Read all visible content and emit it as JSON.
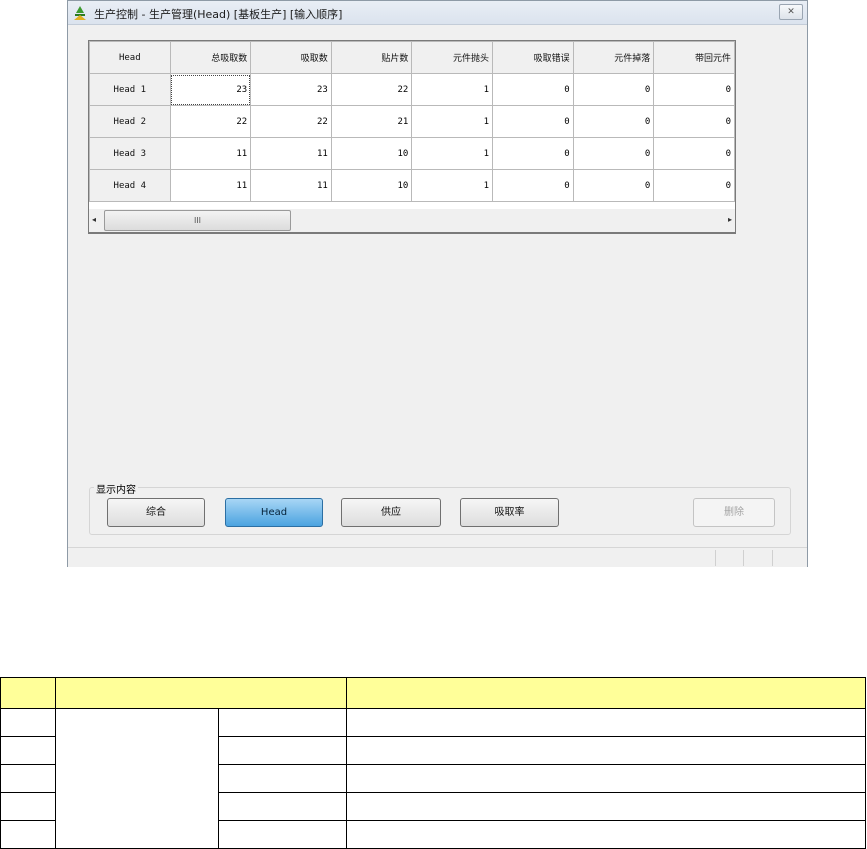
{
  "window": {
    "title": "生产控制  - 生产管理(Head) [基板生产] [输入顺序]",
    "close_symbol": "✕"
  },
  "grid": {
    "corner_header": "Head",
    "columns": [
      "总吸取数",
      "吸取数",
      "贴片数",
      "元件抛头",
      "吸取错误",
      "元件掉落",
      "带回元件"
    ],
    "rows": [
      {
        "label": "Head 1",
        "values": [
          "23",
          "23",
          "22",
          "1",
          "0",
          "0",
          "0"
        ]
      },
      {
        "label": "Head 2",
        "values": [
          "22",
          "22",
          "21",
          "1",
          "0",
          "0",
          "0"
        ]
      },
      {
        "label": "Head 3",
        "values": [
          "11",
          "11",
          "10",
          "1",
          "0",
          "0",
          "0"
        ]
      },
      {
        "label": "Head 4",
        "values": [
          "11",
          "11",
          "10",
          "1",
          "0",
          "0",
          "0"
        ]
      }
    ]
  },
  "scrollbar": {
    "left_arrow": "◂",
    "right_arrow": "▸",
    "thumb_grip": "III"
  },
  "display_group": {
    "label": "显示内容",
    "buttons": {
      "summary": "综合",
      "head": "Head",
      "feeder": "供应",
      "pickup_rate": "吸取率",
      "delete": "删除"
    }
  },
  "colors": {
    "active_button": "#4ba3e0",
    "doc_header": "#ffff99"
  }
}
